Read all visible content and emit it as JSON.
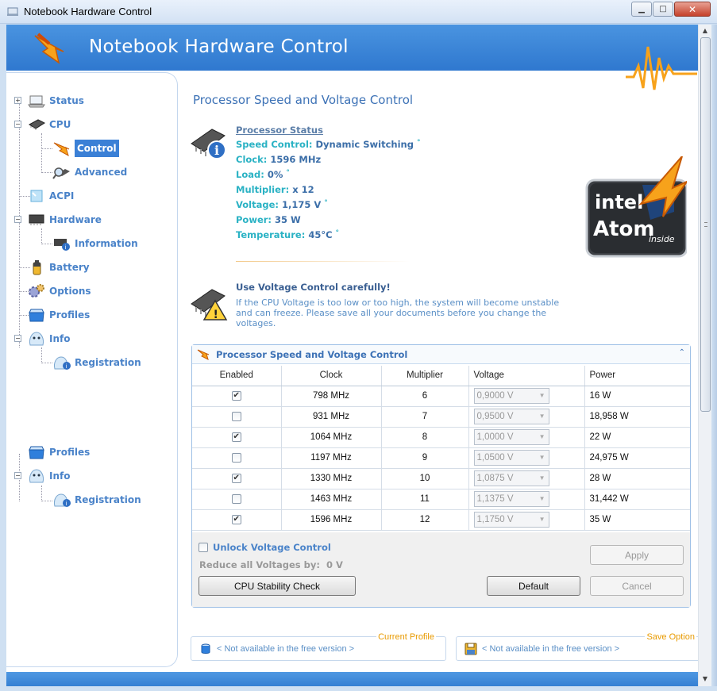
{
  "window": {
    "title": "Notebook Hardware Control",
    "min_label": "▁",
    "max_label": "□",
    "close_label": "✕"
  },
  "header": {
    "app_title": "Notebook Hardware Control"
  },
  "sidebar": {
    "items": [
      {
        "label": "Status"
      },
      {
        "label": "CPU"
      },
      {
        "label": "Control"
      },
      {
        "label": "Advanced"
      },
      {
        "label": "ACPI"
      },
      {
        "label": "Hardware"
      },
      {
        "label": "Information"
      },
      {
        "label": "Battery"
      },
      {
        "label": "Options"
      },
      {
        "label": "Profiles"
      },
      {
        "label": "Info"
      },
      {
        "label": "Registration"
      }
    ],
    "bottom_items": [
      {
        "label": "Profiles"
      },
      {
        "label": "Info"
      },
      {
        "label": "Registration"
      }
    ]
  },
  "main": {
    "title": "Processor Speed and Voltage Control",
    "status": {
      "heading": "Processor Status",
      "rows": [
        {
          "key": "Speed Control:",
          "value": "Dynamic Switching",
          "mark": "°"
        },
        {
          "key": "Clock:",
          "value": "1596 MHz",
          "mark": ""
        },
        {
          "key": "Load:",
          "value": "0%",
          "mark": "°"
        },
        {
          "key": "Multiplier:",
          "value": "x 12",
          "mark": ""
        },
        {
          "key": "Voltage:",
          "value": "1,175 V",
          "mark": "°"
        },
        {
          "key": "Power:",
          "value": "35 W",
          "mark": ""
        },
        {
          "key": "Temperature:",
          "value": "45°C",
          "mark": "°"
        }
      ]
    },
    "badge": {
      "brand": "intel",
      "product": "Atom",
      "suffix": "inside"
    },
    "warning": {
      "title": "Use Voltage Control carefully!",
      "text": "If the CPU Voltage is too low or too high, the system will become unstable and can freeze. Please save all your documents before you change the voltages."
    },
    "control_group": {
      "title": "Processor Speed and Voltage Control",
      "collapse_glyph": "⌃",
      "columns": [
        "Enabled",
        "Clock",
        "Multiplier",
        "Voltage",
        "Power"
      ],
      "rows": [
        {
          "enabled": true,
          "clock": "798 MHz",
          "multiplier": "6",
          "voltage": "0,9000 V",
          "power": "16 W"
        },
        {
          "enabled": false,
          "clock": "931 MHz",
          "multiplier": "7",
          "voltage": "0,9500 V",
          "power": "18,958 W"
        },
        {
          "enabled": true,
          "clock": "1064 MHz",
          "multiplier": "8",
          "voltage": "1,0000 V",
          "power": "22 W"
        },
        {
          "enabled": false,
          "clock": "1197 MHz",
          "multiplier": "9",
          "voltage": "1,0500 V",
          "power": "24,975 W"
        },
        {
          "enabled": true,
          "clock": "1330 MHz",
          "multiplier": "10",
          "voltage": "1,0875 V",
          "power": "28 W"
        },
        {
          "enabled": false,
          "clock": "1463 MHz",
          "multiplier": "11",
          "voltage": "1,1375 V",
          "power": "31,442 W"
        },
        {
          "enabled": true,
          "clock": "1596 MHz",
          "multiplier": "12",
          "voltage": "1,1750 V",
          "power": "35 W"
        }
      ],
      "unlock_label": "Unlock Voltage Control",
      "reduce_label": "Reduce all Voltages by:",
      "reduce_value": "0 V",
      "apply_label": "Apply",
      "stability_label": "CPU Stability Check",
      "default_label": "Default",
      "cancel_label": "Cancel"
    }
  },
  "footer": {
    "current_profile": {
      "label": "Current Profile",
      "value": "< Not available in the free version >"
    },
    "save_options": {
      "label": "Save Option",
      "value": "< Not available in the free version >"
    }
  },
  "colors": {
    "accent": "#3b80d6",
    "header": "#2f78cf",
    "cyan": "#2ab2c4",
    "orange": "#e89a00"
  }
}
